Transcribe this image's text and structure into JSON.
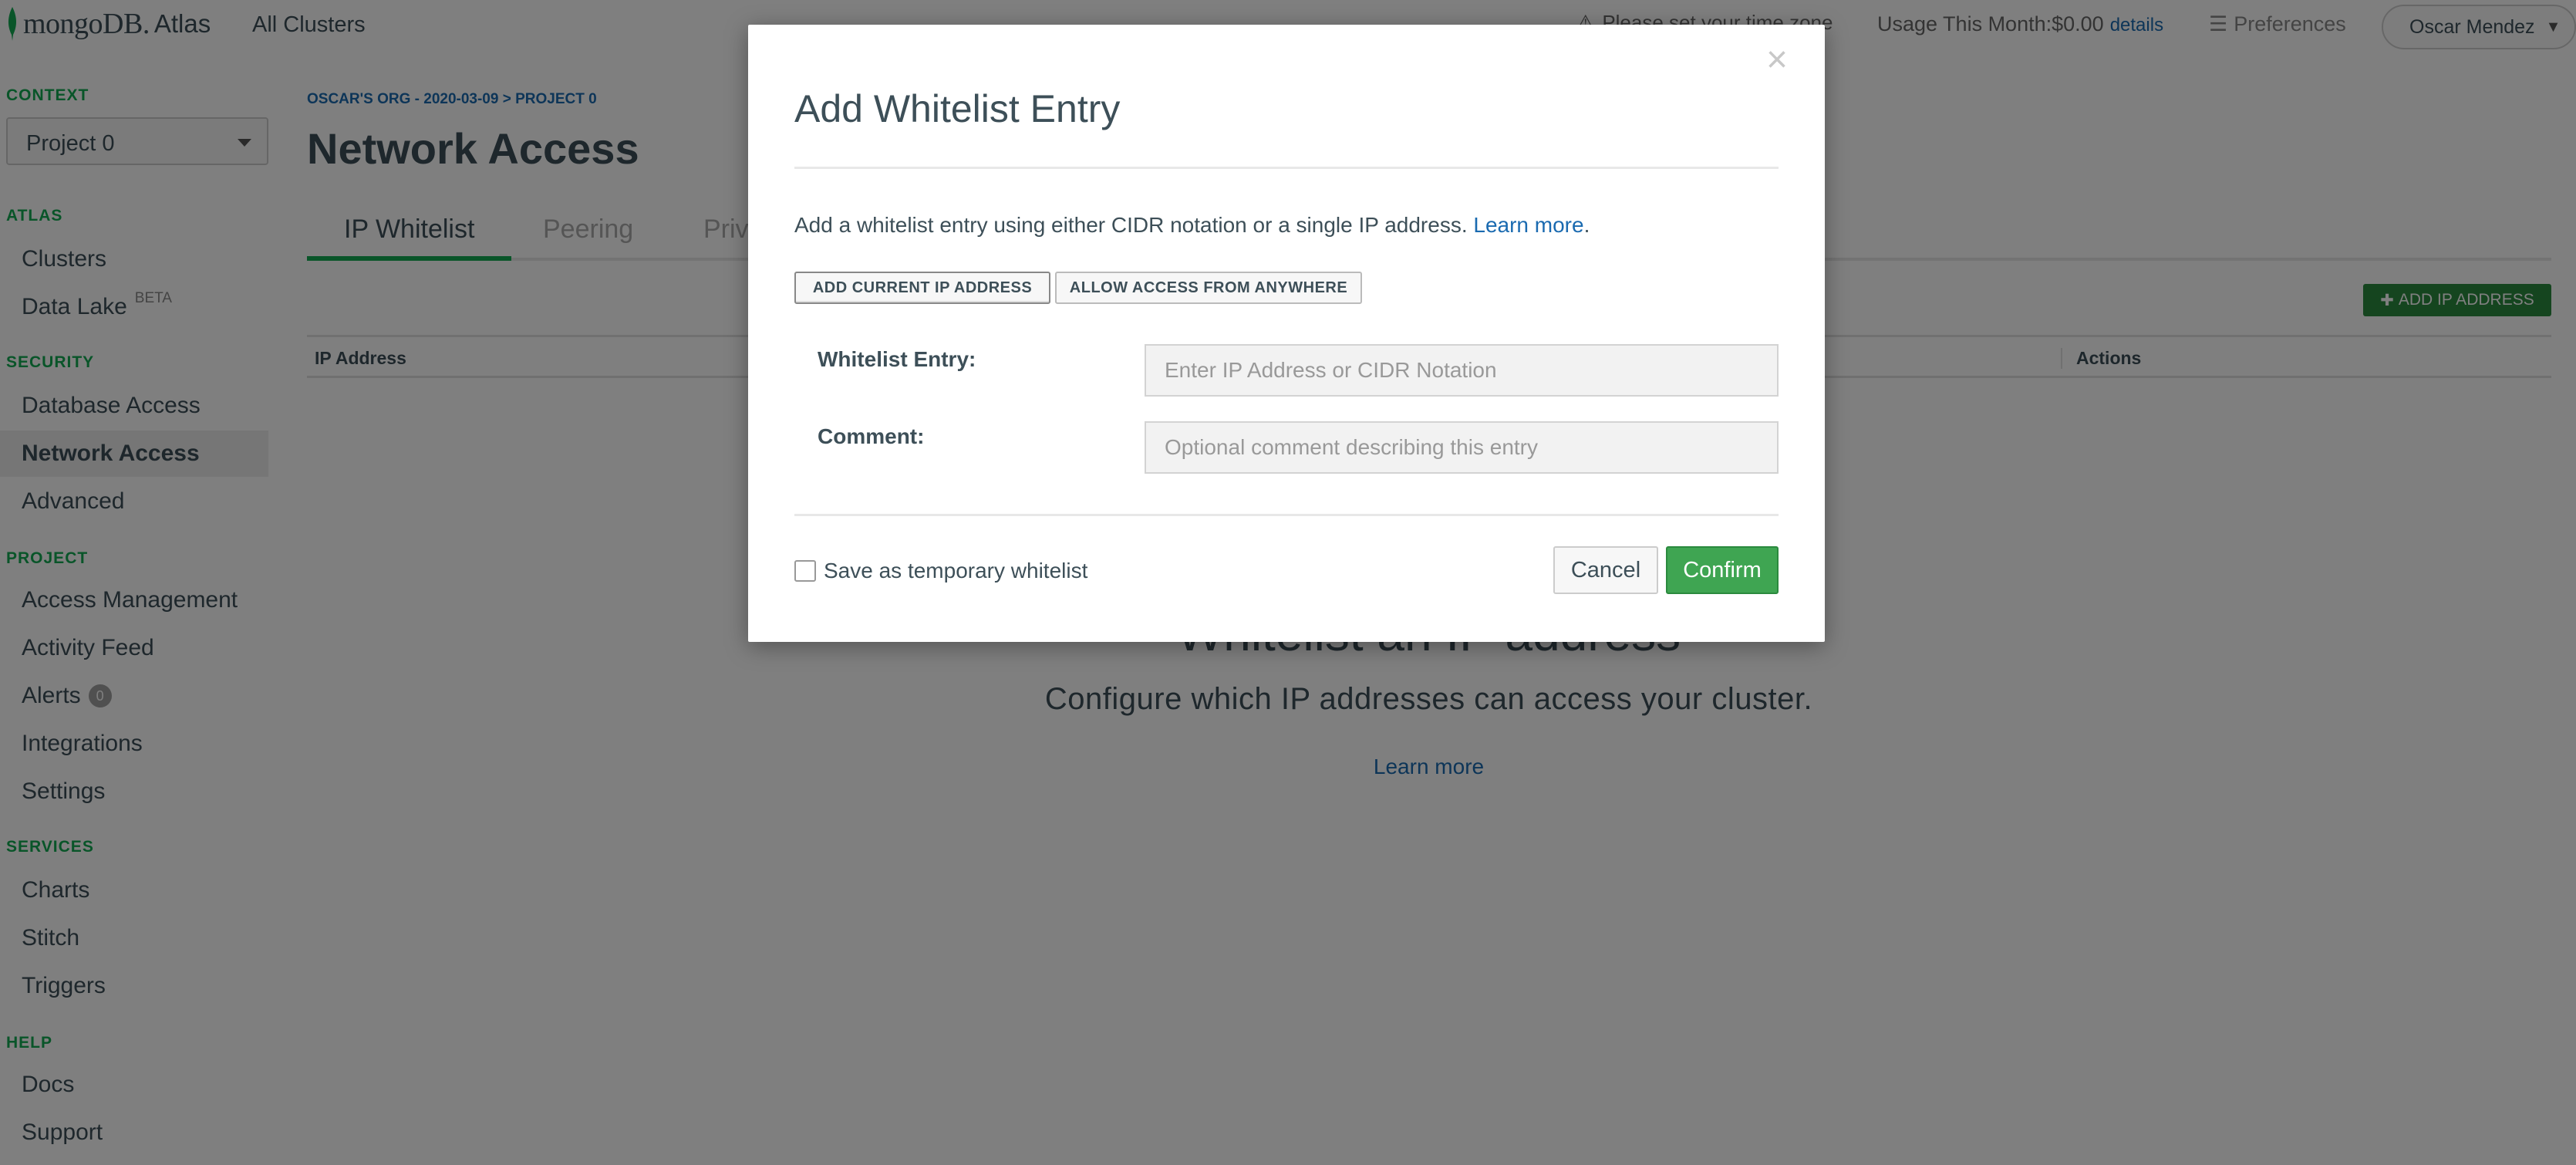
{
  "topbar": {
    "logo_text": "mongoDB.",
    "logo_product": "Atlas",
    "all_clusters": "All Clusters",
    "timezone_warning": "Please set your time zone",
    "usage_label": "Usage This Month:$0.00",
    "usage_details": "details",
    "preferences": "Preferences",
    "user_name": "Oscar Mendez"
  },
  "sidebar": {
    "context_label": "CONTEXT",
    "context_value": "Project 0",
    "sections": [
      {
        "label": "ATLAS",
        "items": [
          {
            "label": "Clusters"
          },
          {
            "label": "Data Lake",
            "badge": "BETA"
          }
        ]
      },
      {
        "label": "SECURITY",
        "items": [
          {
            "label": "Database Access"
          },
          {
            "label": "Network Access"
          },
          {
            "label": "Advanced"
          }
        ]
      },
      {
        "label": "PROJECT",
        "items": [
          {
            "label": "Access Management"
          },
          {
            "label": "Activity Feed"
          },
          {
            "label": "Alerts",
            "count": "0"
          },
          {
            "label": "Integrations"
          },
          {
            "label": "Settings"
          }
        ]
      },
      {
        "label": "SERVICES",
        "items": [
          {
            "label": "Charts"
          },
          {
            "label": "Stitch"
          },
          {
            "label": "Triggers"
          }
        ]
      },
      {
        "label": "HELP",
        "items": [
          {
            "label": "Docs"
          },
          {
            "label": "Support"
          }
        ]
      }
    ],
    "active_item": "Network Access"
  },
  "main": {
    "breadcrumb": "OSCAR'S ORG - 2020-03-09 > PROJECT 0",
    "title": "Network Access",
    "tabs": [
      {
        "label": "IP Whitelist"
      },
      {
        "label": "Peering"
      },
      {
        "label": "Private Endpoint"
      }
    ],
    "add_ip_button": "ADD IP ADDRESS",
    "table_headers": {
      "ip": "IP Address",
      "actions": "Actions"
    },
    "empty_title": "Whitelist an IP address",
    "empty_subtitle": "Configure which IP addresses can access your cluster.",
    "empty_link": "Learn more"
  },
  "modal": {
    "title": "Add Whitelist Entry",
    "description": "Add a whitelist entry using either CIDR notation or a single IP address.",
    "learn_more": "Learn more",
    "add_current_ip": "ADD CURRENT IP ADDRESS",
    "allow_anywhere": "ALLOW ACCESS FROM ANYWHERE",
    "entry_label": "Whitelist Entry:",
    "entry_placeholder": "Enter IP Address or CIDR Notation",
    "comment_label": "Comment:",
    "comment_placeholder": "Optional comment describing this entry",
    "temporary_label": "Save as temporary whitelist",
    "cancel": "Cancel",
    "confirm": "Confirm",
    "close_glyph": "×"
  },
  "colors": {
    "brand_green": "#13aa52",
    "button_green": "#3fa552",
    "link_blue": "#1a6ab0"
  }
}
